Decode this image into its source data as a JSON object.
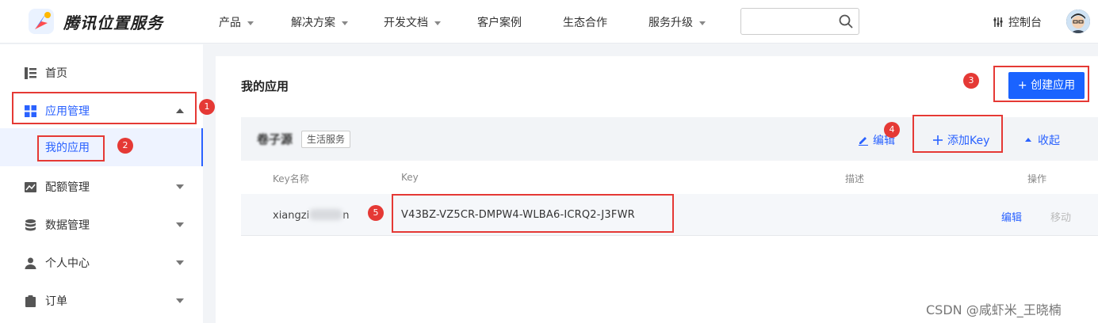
{
  "brand": {
    "name": "腾讯位置服务"
  },
  "nav": [
    {
      "label": "产品",
      "has_caret": true
    },
    {
      "label": "解决方案",
      "has_caret": true
    },
    {
      "label": "开发文档",
      "has_caret": true
    },
    {
      "label": "客户案例",
      "has_caret": false
    },
    {
      "label": "生态合作",
      "has_caret": false
    },
    {
      "label": "服务升级",
      "has_caret": true
    }
  ],
  "search": {
    "value": "",
    "placeholder": "",
    "icon": "search-icon"
  },
  "console": {
    "label": "控制台",
    "icon": "sliders-icon"
  },
  "sidebar": {
    "items": [
      {
        "label": "首页",
        "icon": "list-icon"
      },
      {
        "label": "应用管理",
        "icon": "grid-icon",
        "expanded": true
      },
      {
        "label": "配额管理",
        "icon": "chart-icon"
      },
      {
        "label": "数据管理",
        "icon": "database-icon"
      },
      {
        "label": "个人中心",
        "icon": "user-icon"
      },
      {
        "label": "订单",
        "icon": "clipboard-icon"
      }
    ],
    "sub_items": [
      {
        "label": "我的应用",
        "active": true
      }
    ]
  },
  "main": {
    "title": "我的应用",
    "create_button": "+ 创建应用",
    "app": {
      "name": "卷子源",
      "tag": "生活服务",
      "edit_label": "编辑",
      "add_key_label": "添加Key",
      "collapse_label": "收起"
    },
    "table": {
      "headers": [
        "Key名称",
        "Key",
        "描述",
        "操作"
      ],
      "rows": [
        {
          "key_name_prefix": "xiangzi",
          "key_name_suffix": "n",
          "key": "V43BZ-VZ5CR-DMPW4-WLBA6-ICRQ2-J3FWR",
          "description": "",
          "edit": "编辑",
          "move": "移动"
        }
      ]
    }
  },
  "annotations": [
    "1",
    "2",
    "3",
    "4",
    "5"
  ],
  "watermark": "CSDN @咸虾米_王晓楠",
  "colors": {
    "accent": "#2a62ff",
    "primary_button": "#1a63ff",
    "annotation": "#e53935"
  }
}
